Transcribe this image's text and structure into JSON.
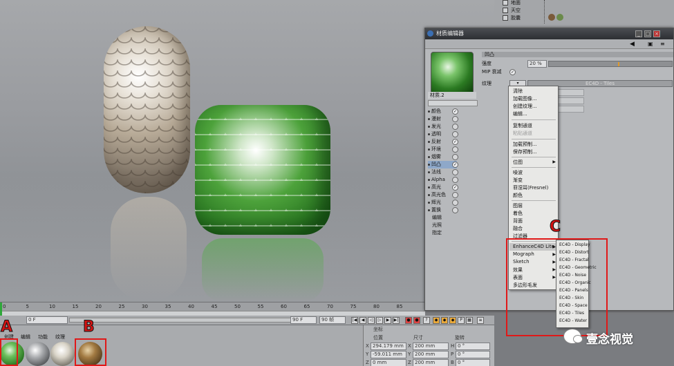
{
  "viewport": {},
  "timeline": {
    "ticks": [
      "0",
      "5",
      "10",
      "15",
      "20",
      "25",
      "30",
      "35",
      "40",
      "45",
      "50",
      "55",
      "60",
      "65",
      "70",
      "75",
      "80",
      "85"
    ]
  },
  "transport": {
    "start_field": "0 F",
    "end_field": "90 F",
    "end_frame": "90 帧"
  },
  "material_manager": {
    "menu": [
      "创建",
      "编辑",
      "功能",
      "纹理"
    ]
  },
  "coordinates": {
    "section": "坐标",
    "col_position": "位置",
    "col_size": "尺寸",
    "col_rotation": "旋转",
    "rows": [
      {
        "axis": "X",
        "position": "294.179 mm",
        "size": "200 mm",
        "rot_label": "H",
        "rotation": "0 °"
      },
      {
        "axis": "Y",
        "position": "-59.011 mm",
        "size": "200 mm",
        "rot_label": "P",
        "rotation": "0 °"
      },
      {
        "axis": "Z",
        "position": "0 mm",
        "size": "200 mm",
        "rot_label": "B",
        "rotation": "0 °"
      }
    ]
  },
  "object_manager": {
    "items": [
      {
        "label": "地面"
      },
      {
        "label": "天空"
      },
      {
        "label": "胶囊"
      }
    ]
  },
  "editor": {
    "title": "材质编辑器",
    "material_name": "材质.2",
    "channels": [
      {
        "label": "颜色",
        "on": true
      },
      {
        "label": "漫射",
        "on": false
      },
      {
        "label": "发光",
        "on": false
      },
      {
        "label": "透明",
        "on": false
      },
      {
        "label": "反射",
        "on": true
      },
      {
        "label": "环境",
        "on": false
      },
      {
        "label": "烟雾",
        "on": false
      },
      {
        "label": "凹凸",
        "on": true,
        "selected": true
      },
      {
        "label": "法线",
        "on": false
      },
      {
        "label": "Alpha",
        "on": false
      },
      {
        "label": "高光",
        "on": true
      },
      {
        "label": "高光色",
        "on": false
      },
      {
        "label": "辉光",
        "on": false
      },
      {
        "label": "置换",
        "on": false
      },
      {
        "label": "编辑",
        "on": null
      },
      {
        "label": "光照",
        "on": null
      },
      {
        "label": "指定",
        "on": null
      }
    ],
    "section_title": "凹凸",
    "strength_label": "强度",
    "strength_value": "20 %",
    "mip_label": "MIP 衰减",
    "texture_label": "纹理",
    "texture_value": "EC4D - Tiles"
  },
  "context_menu": {
    "groups": [
      [
        "清除",
        "加载图像...",
        "创建纹理...",
        "编辑..."
      ],
      [
        "复制通道",
        "粘贴通道"
      ],
      [
        "加载预制...",
        "保存预制..."
      ],
      [
        "位图"
      ],
      [
        "噪波",
        "渐变",
        "菲涅耳(Fresnel)",
        "颜色"
      ],
      [
        "图层",
        "着色",
        "背面",
        "融合",
        "过滤器"
      ],
      [
        "EnhanceC4D Lite",
        "Mograph",
        "Sketch",
        "效果",
        "表面",
        "多边形毛发"
      ]
    ],
    "disabled": [
      "粘贴通道"
    ],
    "has_submenu": [
      "位图",
      "EnhanceC4D Lite",
      "Mograph",
      "Sketch",
      "效果",
      "表面"
    ],
    "highlighted": "EnhanceC4D Lite"
  },
  "submenu": {
    "items": [
      "EC4D - Display",
      "EC4D - Distort",
      "EC4D - Fractal",
      "EC4D - Geometric",
      "EC4D - Noise",
      "EC4D - Organic",
      "EC4D - Panels",
      "EC4D - Skin",
      "EC4D - Space",
      "EC4D - Tiles",
      "EC4D - Water"
    ]
  },
  "annotations": {
    "a": "A",
    "b": "B",
    "c": "C"
  },
  "watermark": {
    "text": "壹念视觉"
  },
  "colors": {
    "annotation_red": "#e01818",
    "timeline_accent": "#e09a2a",
    "selected_channel": "#8ea8c9"
  }
}
